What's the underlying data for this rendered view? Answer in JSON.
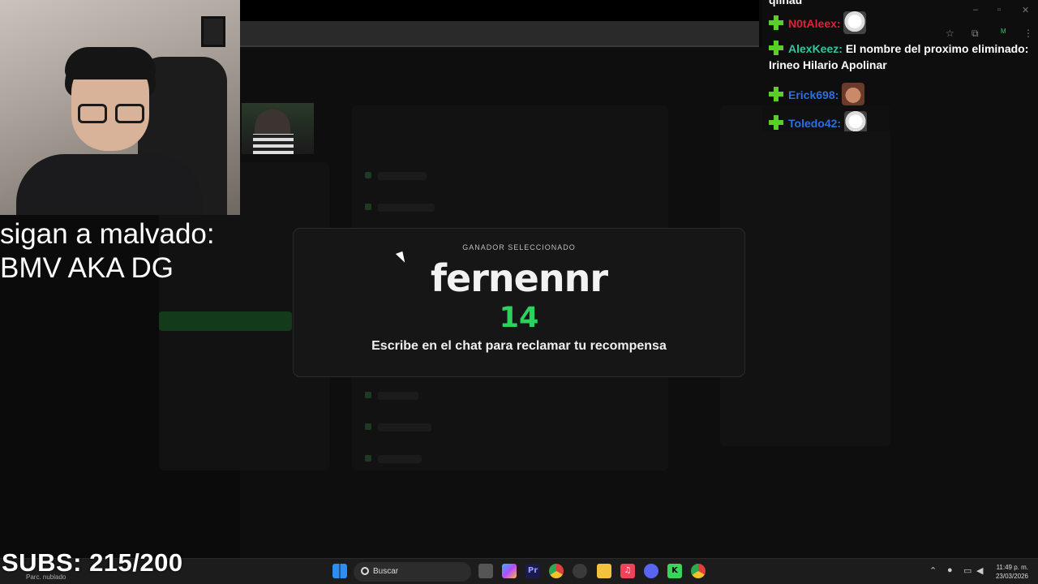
{
  "overlay": {
    "line1": "sigan a malvado:",
    "line2": "BMV AKA DG",
    "subs": "SUBS: 215/200"
  },
  "modal": {
    "eyebrow": "GANADOR SELECCIONADO",
    "winner": "fernennr",
    "number": "14",
    "message": "Escribe en el chat para reclamar tu recompensa",
    "number_color": "#2ad35c"
  },
  "chat": {
    "cut_text": "qlinau",
    "messages": [
      {
        "user": "N0tAleex:",
        "text": "",
        "color": "#e0203a",
        "emote": "dog"
      },
      {
        "user": "AlexKeez:",
        "text": "El nombre del proximo eliminado:",
        "color": "#2fc7a0",
        "emote": ""
      },
      {
        "user": "Erick698:",
        "text": "",
        "color": "#2b6fe0",
        "emote": "face"
      },
      {
        "user": "Toledo42:",
        "text": "",
        "color": "#2b6fe0",
        "emote": "dog"
      }
    ],
    "continuation": "Irineo Hilario Apolinar",
    "badge_color": "#59d027"
  },
  "taskbar": {
    "weather": "Parc. nublado",
    "search_label": "Buscar",
    "time": "11:49 p. m.",
    "date": "23/03/2026",
    "icons": [
      "windows-icon",
      "task-view-icon",
      "copilot-icon",
      "premiere-icon",
      "chrome-icon",
      "steam-icon",
      "explorer-icon",
      "music-icon",
      "discord-icon",
      "kick-icon",
      "chrome-active-icon"
    ]
  }
}
